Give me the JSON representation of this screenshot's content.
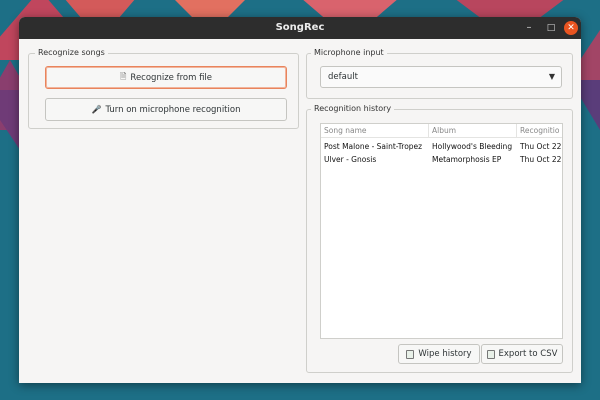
{
  "window": {
    "title": "SongRec",
    "controls": {
      "minimize": "–",
      "maximize": "□",
      "close": "✕"
    }
  },
  "recognize": {
    "frame_label": "Recognize songs",
    "file_button": "Recognize from file",
    "file_icon": "file-icon",
    "mic_button": "Turn on microphone recognition",
    "mic_icon": "microphone-icon"
  },
  "microphone": {
    "frame_label": "Microphone input",
    "selected": "default"
  },
  "history": {
    "frame_label": "Recognition history",
    "columns": [
      "Song name",
      "Album",
      "Recognitio"
    ],
    "rows": [
      [
        "Post Malone - Saint-Tropez",
        "Hollywood's Bleeding",
        "Thu Oct 22"
      ],
      [
        "Ulver - Gnosis",
        "Metamorphosis EP",
        "Thu Oct 22"
      ]
    ],
    "wipe_button": "Wipe history",
    "export_button": "Export to CSV"
  },
  "colors": {
    "accent": "#e95420",
    "titlebar": "#2d2d2d",
    "window_bg": "#f6f5f4"
  }
}
